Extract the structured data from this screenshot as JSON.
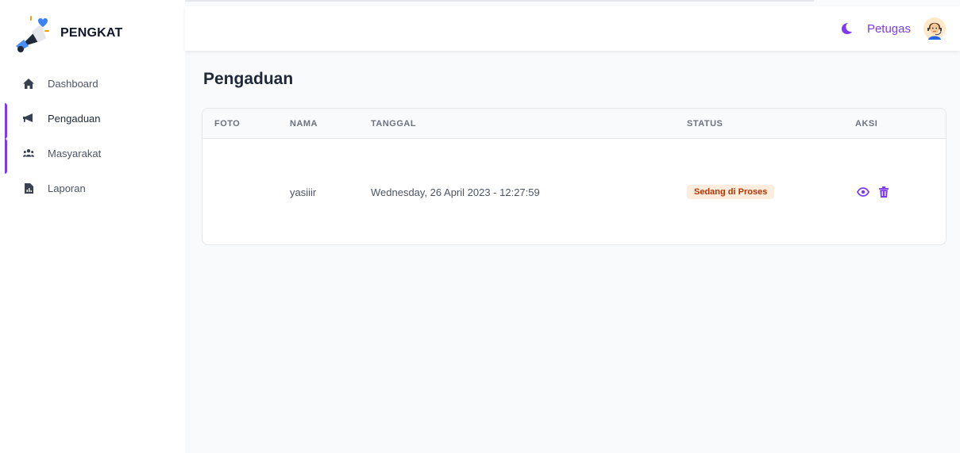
{
  "brand": {
    "name": "PENGKAT"
  },
  "nav": {
    "items": [
      {
        "label": "Dashboard",
        "icon": "home-icon"
      },
      {
        "label": "Pengaduan",
        "icon": "megaphone-icon",
        "active": true
      },
      {
        "label": "Masyarakat",
        "icon": "users-icon"
      },
      {
        "label": "Laporan",
        "icon": "report-icon"
      }
    ]
  },
  "header": {
    "user_name": "Petugas",
    "theme_icon": "moon-icon",
    "avatar_icon": "avatar-icon"
  },
  "page": {
    "title": "Pengaduan"
  },
  "table": {
    "columns": [
      "FOTO",
      "NAMA",
      "TANGGAL",
      "STATUS",
      "AKSI"
    ],
    "rows": [
      {
        "foto": "",
        "nama": "yasiiir",
        "tanggal": "Wednesday, 26 April 2023 - 12:27:59",
        "status": "Sedang di Proses",
        "actions": [
          "eye-icon",
          "trash-icon"
        ]
      }
    ]
  },
  "colors": {
    "accent": "#7e3af2",
    "badge_bg": "#feecdc",
    "badge_text": "#b43403"
  }
}
